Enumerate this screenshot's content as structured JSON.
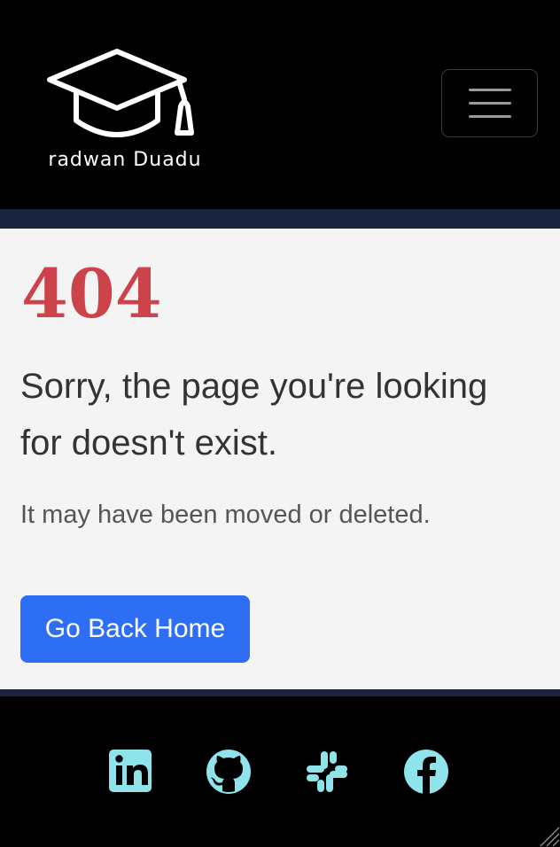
{
  "brand": {
    "name": "radwan Duadu",
    "logo_icon": "graduation-cap-icon"
  },
  "nav": {
    "toggle_icon": "hamburger-menu-icon"
  },
  "error": {
    "code": "404",
    "title": "Sorry, the page you're looking for doesn't exist.",
    "subtitle": "It may have been moved or deleted.",
    "button_label": "Go Back Home"
  },
  "footer": {
    "social": [
      {
        "icon": "linkedin-icon"
      },
      {
        "icon": "github-icon"
      },
      {
        "icon": "slack-icon"
      },
      {
        "icon": "facebook-icon"
      }
    ]
  },
  "colors": {
    "background": "#000000",
    "accent_band": "#1a2340",
    "content_bg": "#f4f4f4",
    "error_code": "#cc4449",
    "button": "#2e6ef5",
    "social_icons": "#8fe3ea"
  }
}
